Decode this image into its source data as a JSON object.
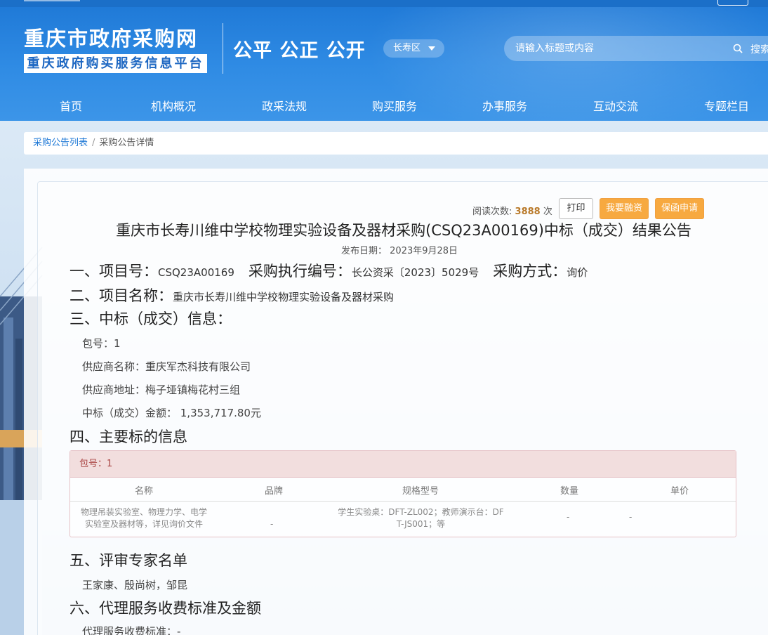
{
  "header": {
    "site_title": "重庆市政府采购网",
    "site_subtitle": "重庆政府购买服务信息平台",
    "slogan": "公平 公正 公开",
    "region_select": "长寿区",
    "search_placeholder": "请输入标题或内容",
    "search_label": "搜索"
  },
  "nav": [
    "首页",
    "机构概况",
    "政采法规",
    "购买服务",
    "办事服务",
    "互动交流",
    "专题栏目"
  ],
  "breadcrumb": {
    "list": "采购公告列表",
    "sep": "/",
    "current": "采购公告详情"
  },
  "toolbar": {
    "reads_label": "阅读次数:",
    "reads_count": "3888",
    "reads_unit": "次",
    "print": "打印",
    "financing": "我要融资",
    "guarantee": "保函申请"
  },
  "article": {
    "title": "重庆市长寿川维中学校物理实验设备及器材采购(CSQ23A00169)中标（成交）结果公告",
    "date_label": "发布日期：",
    "date": "2023年9月28日",
    "sec1": {
      "project_no_label": "一、项目号：",
      "project_no": "CSQ23A00169",
      "exec_no_label": "采购执行编号：",
      "exec_no": "长公资采〔2023〕5029号",
      "method_label": "采购方式：",
      "method": "询价"
    },
    "sec2": {
      "label": "二、项目名称：",
      "value": "重庆市长寿川维中学校物理实验设备及器材采购"
    },
    "sec3": {
      "label": "三、中标（成交）信息：",
      "package": "包号：1",
      "supplier": "供应商名称：重庆军杰科技有限公司",
      "address": "供应商地址：梅子垭镇梅花村三组",
      "amount": "中标（成交）金额：  1,353,717.80元"
    },
    "sec4": {
      "label": "四、主要标的信息",
      "package": "包号：1",
      "columns": [
        "名称",
        "品牌",
        "规格型号",
        "数量",
        "单价"
      ],
      "rows": [
        {
          "name_line1": "物理吊装实验室、物理力学、电学",
          "name_line2": "实验室及器材等，详见询价文件",
          "brand": "-",
          "spec_line1": "学生实验桌：DFT-ZL002；教师演示台：DF",
          "spec_line2": "T-JS001；等",
          "qty": "-",
          "price": "-"
        }
      ]
    },
    "sec5": {
      "label": "五、评审专家名单",
      "value": "王家康、殷尚树，邹昆"
    },
    "sec6": {
      "label": "六、代理服务收费标准及金额",
      "fee_std": "代理服务收费标准：-"
    }
  },
  "colors": {
    "header_blue": "#2f8be4",
    "link_blue": "#1e78d6",
    "button_orange": "#f7a940",
    "alert_pink": "#f2dede"
  }
}
